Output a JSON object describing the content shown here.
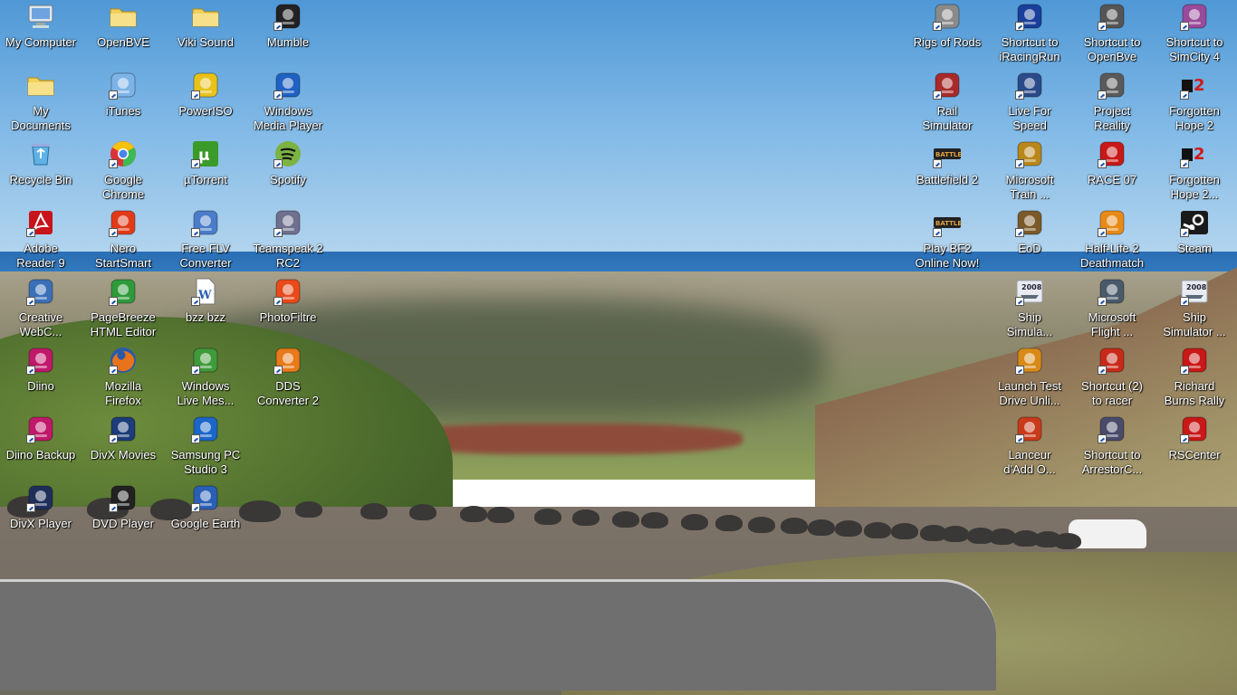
{
  "desktop": {
    "left_icons": [
      {
        "label": "My Computer",
        "icon": "my-computer-icon",
        "shortcut": false,
        "col": 0,
        "row": 0
      },
      {
        "label": "OpenBVE",
        "icon": "folder-icon",
        "shortcut": false,
        "col": 1,
        "row": 0
      },
      {
        "label": "Viki Sound",
        "icon": "folder-icon",
        "shortcut": false,
        "col": 2,
        "row": 0
      },
      {
        "label": "Mumble",
        "icon": "mumble-icon",
        "shortcut": true,
        "col": 3,
        "row": 0
      },
      {
        "label": "My\nDocuments",
        "icon": "my-documents-icon",
        "shortcut": false,
        "col": 0,
        "row": 1
      },
      {
        "label": "iTunes",
        "icon": "itunes-icon",
        "shortcut": true,
        "col": 1,
        "row": 1
      },
      {
        "label": "PowerISO",
        "icon": "poweriso-icon",
        "shortcut": true,
        "col": 2,
        "row": 1
      },
      {
        "label": "Windows\nMedia Player",
        "icon": "windows-media-player-icon",
        "shortcut": true,
        "col": 3,
        "row": 1
      },
      {
        "label": "Recycle Bin",
        "icon": "recycle-bin-icon",
        "shortcut": false,
        "col": 0,
        "row": 2
      },
      {
        "label": "Google\nChrome",
        "icon": "chrome-icon",
        "shortcut": true,
        "col": 1,
        "row": 2
      },
      {
        "label": "µTorrent",
        "icon": "utorrent-icon",
        "shortcut": true,
        "col": 2,
        "row": 2
      },
      {
        "label": "Spotify",
        "icon": "spotify-icon",
        "shortcut": true,
        "col": 3,
        "row": 2
      },
      {
        "label": "Adobe\nReader 9",
        "icon": "adobe-reader-icon",
        "shortcut": true,
        "col": 0,
        "row": 3
      },
      {
        "label": "Nero\nStartSmart",
        "icon": "nero-icon",
        "shortcut": true,
        "col": 1,
        "row": 3
      },
      {
        "label": "Free FLV\nConverter",
        "icon": "flv-converter-icon",
        "shortcut": true,
        "col": 2,
        "row": 3
      },
      {
        "label": "Teamspeak 2\nRC2",
        "icon": "teamspeak-icon",
        "shortcut": true,
        "col": 3,
        "row": 3
      },
      {
        "label": "Creative\nWebC...",
        "icon": "webcam-icon",
        "shortcut": true,
        "col": 0,
        "row": 4
      },
      {
        "label": "PageBreeze\nHTML Editor",
        "icon": "pagebreeze-icon",
        "shortcut": true,
        "col": 1,
        "row": 4
      },
      {
        "label": "bzz bzz",
        "icon": "word-document-icon",
        "shortcut": true,
        "col": 2,
        "row": 4
      },
      {
        "label": "PhotoFiltre",
        "icon": "photofiltre-icon",
        "shortcut": true,
        "col": 3,
        "row": 4
      },
      {
        "label": "Diino",
        "icon": "diino-icon",
        "shortcut": true,
        "col": 0,
        "row": 5
      },
      {
        "label": "Mozilla\nFirefox",
        "icon": "firefox-icon",
        "shortcut": true,
        "col": 1,
        "row": 5
      },
      {
        "label": "Windows\nLive Mes...",
        "icon": "windows-live-messenger-icon",
        "shortcut": true,
        "col": 2,
        "row": 5
      },
      {
        "label": "DDS\nConverter 2",
        "icon": "dds-converter-icon",
        "shortcut": true,
        "col": 3,
        "row": 5
      },
      {
        "label": "Diino Backup",
        "icon": "diino-backup-icon",
        "shortcut": true,
        "col": 0,
        "row": 6
      },
      {
        "label": "DivX Movies",
        "icon": "divx-movies-icon",
        "shortcut": true,
        "col": 1,
        "row": 6
      },
      {
        "label": "Samsung PC\nStudio 3",
        "icon": "samsung-pc-studio-icon",
        "shortcut": true,
        "col": 2,
        "row": 6
      },
      {
        "label": "DivX Player",
        "icon": "divx-player-icon",
        "shortcut": true,
        "col": 0,
        "row": 7
      },
      {
        "label": "DVD Player",
        "icon": "dvd-player-icon",
        "shortcut": true,
        "col": 1,
        "row": 7
      },
      {
        "label": "Google Earth",
        "icon": "google-earth-icon",
        "shortcut": true,
        "col": 2,
        "row": 7
      }
    ],
    "right_icons": [
      {
        "label": "Rigs of Rods",
        "icon": "rigs-of-rods-icon",
        "shortcut": true,
        "col": 0,
        "row": 0
      },
      {
        "label": "Shortcut to\niRacingRun",
        "icon": "iracing-icon",
        "shortcut": true,
        "col": 1,
        "row": 0
      },
      {
        "label": "Shortcut to\nOpenBve",
        "icon": "openbve-icon",
        "shortcut": true,
        "col": 2,
        "row": 0
      },
      {
        "label": "Shortcut to\nSimCity 4",
        "icon": "simcity-icon",
        "shortcut": true,
        "col": 3,
        "row": 0
      },
      {
        "label": "Rail\nSimulator",
        "icon": "rail-simulator-icon",
        "shortcut": true,
        "col": 0,
        "row": 1
      },
      {
        "label": "Live For\nSpeed",
        "icon": "live-for-speed-icon",
        "shortcut": true,
        "col": 1,
        "row": 1
      },
      {
        "label": "Project\nReality",
        "icon": "project-reality-icon",
        "shortcut": true,
        "col": 2,
        "row": 1
      },
      {
        "label": "Forgotten\nHope 2",
        "icon": "forgotten-hope-icon",
        "shortcut": true,
        "col": 3,
        "row": 1
      },
      {
        "label": "Battlefield 2",
        "icon": "battlefield-icon",
        "shortcut": true,
        "col": 0,
        "row": 2
      },
      {
        "label": "Microsoft\nTrain ...",
        "icon": "train-simulator-icon",
        "shortcut": true,
        "col": 1,
        "row": 2
      },
      {
        "label": "RACE 07",
        "icon": "race07-icon",
        "shortcut": true,
        "col": 2,
        "row": 2
      },
      {
        "label": "Forgotten\nHope 2...",
        "icon": "forgotten-hope-icon",
        "shortcut": true,
        "col": 3,
        "row": 2
      },
      {
        "label": "Play BF2\nOnline Now!",
        "icon": "battlefield-icon",
        "shortcut": true,
        "col": 0,
        "row": 3
      },
      {
        "label": "EoD",
        "icon": "eod-icon",
        "shortcut": true,
        "col": 1,
        "row": 3
      },
      {
        "label": "Half-Life 2\nDeathmatch",
        "icon": "half-life-icon",
        "shortcut": true,
        "col": 2,
        "row": 3
      },
      {
        "label": "Steam",
        "icon": "steam-icon",
        "shortcut": true,
        "col": 3,
        "row": 3
      },
      {
        "label": "Ship\nSimula...",
        "icon": "ship-simulator-icon",
        "shortcut": true,
        "col": 1,
        "row": 4
      },
      {
        "label": "Microsoft\nFlight ...",
        "icon": "flight-simulator-icon",
        "shortcut": true,
        "col": 2,
        "row": 4
      },
      {
        "label": "Ship\nSimulator ...",
        "icon": "ship-simulator-icon",
        "shortcut": true,
        "col": 3,
        "row": 4
      },
      {
        "label": "Launch Test\nDrive Unli...",
        "icon": "test-drive-icon",
        "shortcut": true,
        "col": 1,
        "row": 5
      },
      {
        "label": "Shortcut (2)\nto racer",
        "icon": "racer-icon",
        "shortcut": true,
        "col": 2,
        "row": 5
      },
      {
        "label": "Richard\nBurns Rally",
        "icon": "richard-burns-rally-icon",
        "shortcut": true,
        "col": 3,
        "row": 5
      },
      {
        "label": "Lanceur\nd'Add O...",
        "icon": "lanceur-icon",
        "shortcut": true,
        "col": 1,
        "row": 6
      },
      {
        "label": "Shortcut to\nArrestorC...",
        "icon": "arrestor-icon",
        "shortcut": true,
        "col": 2,
        "row": 6
      },
      {
        "label": "RSCenter",
        "icon": "rscenter-icon",
        "shortcut": true,
        "col": 3,
        "row": 6
      }
    ]
  },
  "icon_colors": {
    "my-computer-icon": "#6fa3e0",
    "folder-icon": "#f2d15a",
    "mumble-icon": "#222222",
    "my-documents-icon": "#f2d15a",
    "itunes-icon": "#7db4e8",
    "poweriso-icon": "#e8c21a",
    "windows-media-player-icon": "#1f62c4",
    "recycle-bin-icon": "#5fb2e6",
    "chrome-icon": "#d93b2b",
    "utorrent-icon": "#3a9a2a",
    "spotify-icon": "#7cb342",
    "adobe-reader-icon": "#c8141b",
    "nero-icon": "#e23a18",
    "flv-converter-icon": "#4a7cc9",
    "teamspeak-icon": "#6f6f8f",
    "webcam-icon": "#3b6fb8",
    "pagebreeze-icon": "#2e9a3a",
    "word-document-icon": "#2c5eb0",
    "photofiltre-icon": "#e84a1a",
    "diino-icon": "#c0186a",
    "firefox-icon": "#e8731a",
    "windows-live-messenger-icon": "#3f9a3a",
    "dds-converter-icon": "#e87a1a",
    "diino-backup-icon": "#c0186a",
    "divx-movies-icon": "#1c3c7a",
    "samsung-pc-studio-icon": "#1a66c9",
    "divx-player-icon": "#1f2f5a",
    "dvd-player-icon": "#222222",
    "google-earth-icon": "#2a5fb5",
    "rigs-of-rods-icon": "#8a8a8a",
    "iracing-icon": "#1a3f9a",
    "openbve-icon": "#555555",
    "simcity-icon": "#9a4a9a",
    "rail-simulator-icon": "#a82a2a",
    "live-for-speed-icon": "#2a4a8a",
    "project-reality-icon": "#5a5a5a",
    "forgotten-hope-icon": "#d01818",
    "battlefield-icon": "#6a3a1a",
    "train-simulator-icon": "#b8861a",
    "race07-icon": "#c81818",
    "eod-icon": "#7a5a2a",
    "half-life-icon": "#e88a18",
    "steam-icon": "#1a1a1a",
    "ship-simulator-icon": "#9aa0aa",
    "flight-simulator-icon": "#4a5a6a",
    "test-drive-icon": "#d88a18",
    "racer-icon": "#c82a1a",
    "richard-burns-rally-icon": "#c81818",
    "lanceur-icon": "#c83a1a",
    "arrestor-icon": "#4a4a6a",
    "rscenter-icon": "#c81818"
  }
}
